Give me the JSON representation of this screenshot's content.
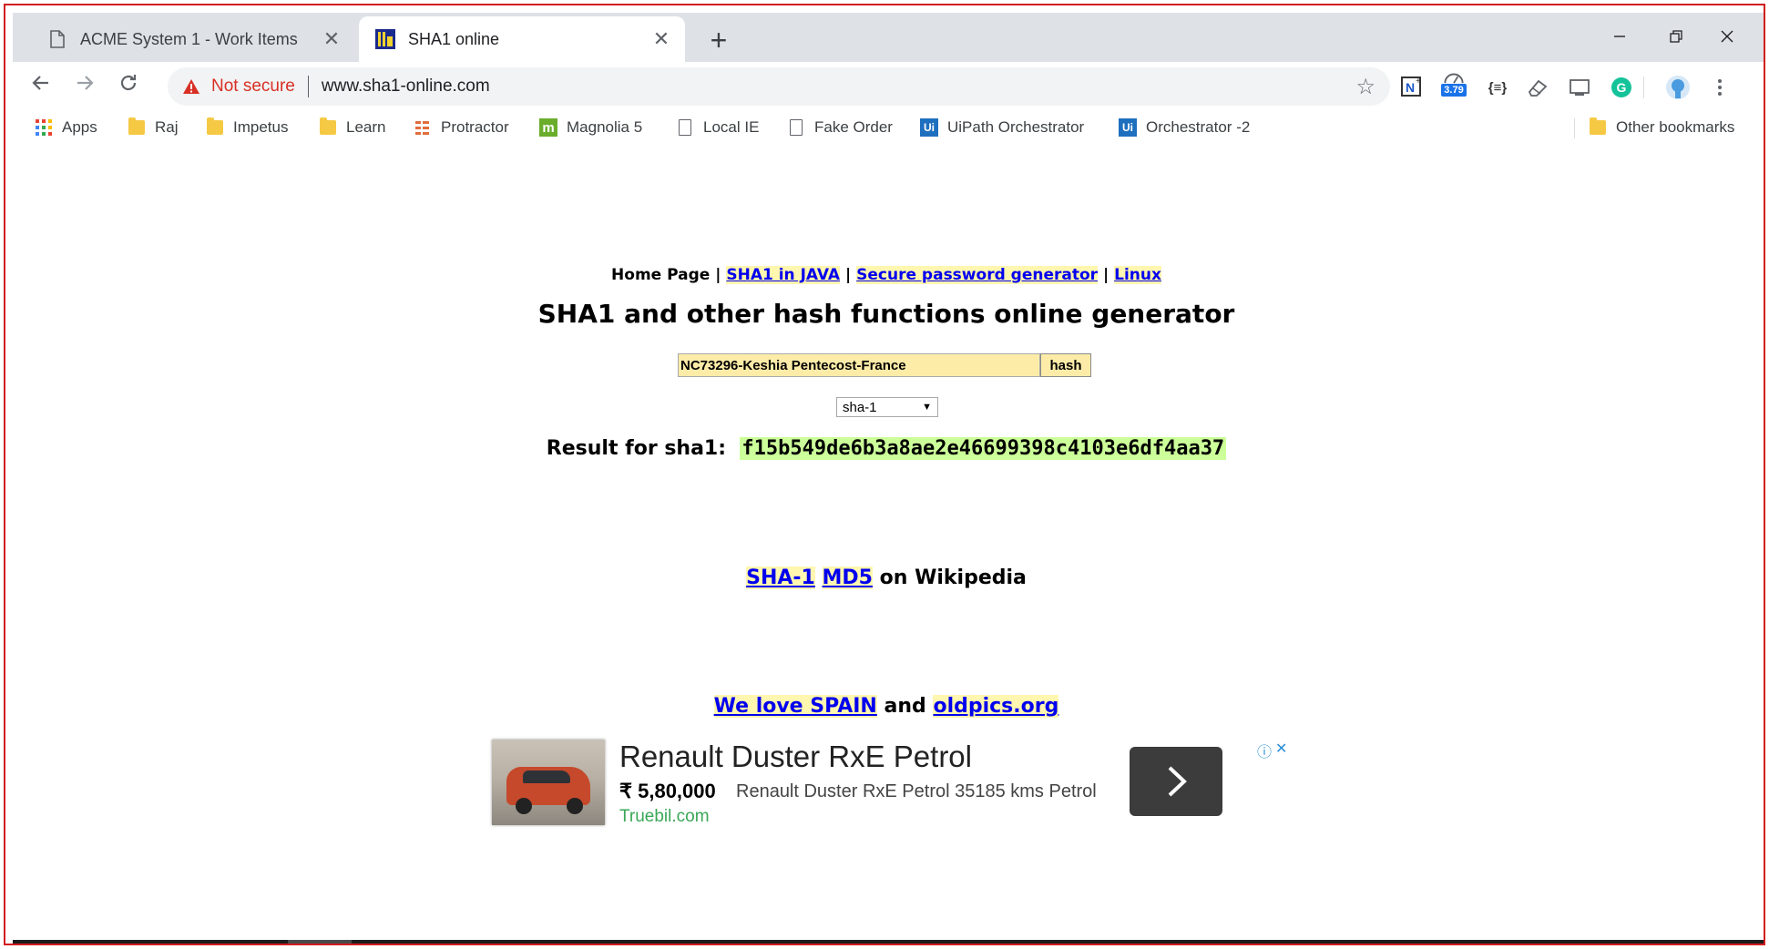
{
  "browser": {
    "tabs": [
      {
        "title": "ACME System 1 - Work Items",
        "active": false
      },
      {
        "title": "SHA1 online",
        "active": true
      }
    ],
    "omnibox": {
      "security_label": "Not secure",
      "url": "www.sha1-online.com"
    },
    "extensions": {
      "badge_value": "3.79",
      "json_label": "{≡}"
    },
    "bookmarks": [
      {
        "label": "Apps",
        "icon": "apps-grid-icon"
      },
      {
        "label": "Raj",
        "icon": "folder-icon"
      },
      {
        "label": "Impetus",
        "icon": "folder-icon"
      },
      {
        "label": "Learn",
        "icon": "folder-icon"
      },
      {
        "label": "Protractor",
        "icon": "protractor-icon"
      },
      {
        "label": "Magnolia 5",
        "icon": "magnolia-icon"
      },
      {
        "label": "Local IE",
        "icon": "page-icon"
      },
      {
        "label": "Fake Order",
        "icon": "page-icon"
      },
      {
        "label": "UiPath Orchestrator",
        "icon": "uipath-icon"
      },
      {
        "label": "Orchestrator -2",
        "icon": "uipath-icon"
      }
    ],
    "other_bookmarks": "Other bookmarks"
  },
  "page": {
    "nav": {
      "home": "Home Page",
      "sep": "|",
      "link1": "SHA1 in JAVA",
      "link2": "Secure password generator",
      "link3": "Linux"
    },
    "heading": "SHA1 and other hash functions online generator",
    "form": {
      "input_value": "NC73296-Keshia Pentecost-France",
      "button_label": "hash",
      "algorithm": "sha-1"
    },
    "result": {
      "label": "Result for sha1:",
      "value": "f15b549de6b3a8ae2e46699398c4103e6df4aa37"
    },
    "wiki": {
      "link1": "SHA-1",
      "link2": "MD5",
      "suffix": "on Wikipedia"
    },
    "promo": {
      "link1": "We love SPAIN",
      "conj": "and",
      "link2": "oldpics.org"
    },
    "ad": {
      "title": "Renault Duster RxE Petrol",
      "price": "₹ 5,80,000",
      "description": "Renault Duster RxE Petrol 35185 kms Petrol",
      "domain": "Truebil.com"
    }
  },
  "colors": {
    "security_warning": "#d93025",
    "link": "#0000ee",
    "link_highlight": "#fff6b0",
    "input_bg": "#fdeca8",
    "result_bg": "#ccff99",
    "frame_border": "#d21d1d"
  }
}
